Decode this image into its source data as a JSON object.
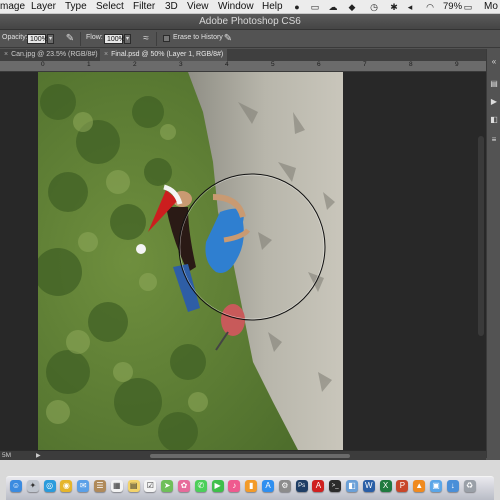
{
  "menubar": {
    "items": [
      "mage",
      "Layer",
      "Type",
      "Select",
      "Filter",
      "3D",
      "View",
      "Window",
      "Help"
    ],
    "battery": "79%",
    "user": "Mo"
  },
  "window": {
    "title": "Adobe Photoshop CS6"
  },
  "options_bar": {
    "opacity_label": "Opacity:",
    "opacity_value": "100%",
    "flow_label": "Flow:",
    "flow_value": "100%",
    "erase_history_label": "Erase to History"
  },
  "tabs": [
    {
      "label": "Can.jpg @ 23.5% (RGB/8#)",
      "active": false
    },
    {
      "label": "Final.psd @ 50% (Layer 1, RGB/8#)",
      "active": true
    }
  ],
  "ruler": {
    "labels": [
      "0",
      "1",
      "2",
      "3",
      "4",
      "5",
      "6",
      "7",
      "8",
      "9"
    ]
  },
  "statusbar": {
    "doc_info": "5M"
  },
  "colors": {
    "accent": "#d42020",
    "workspace": "#282828",
    "panel": "#535353"
  },
  "dock": {
    "apps": [
      "finder-icon",
      "launchpad-icon",
      "safari-icon",
      "chrome-icon",
      "mail-icon",
      "contacts-icon",
      "calendar-icon",
      "notes-icon",
      "reminders-icon",
      "maps-icon",
      "photos-icon",
      "messages-icon",
      "facetime-icon",
      "itunes-icon",
      "ibooks-icon",
      "appstore-icon",
      "preferences-icon",
      "photoshop-icon",
      "acrobat-icon",
      "terminal-icon",
      "preview-icon",
      "word-icon",
      "excel-icon",
      "powerpoint-icon",
      "vlc-icon",
      "folder-icon",
      "downloads-icon",
      "trash-icon"
    ]
  }
}
